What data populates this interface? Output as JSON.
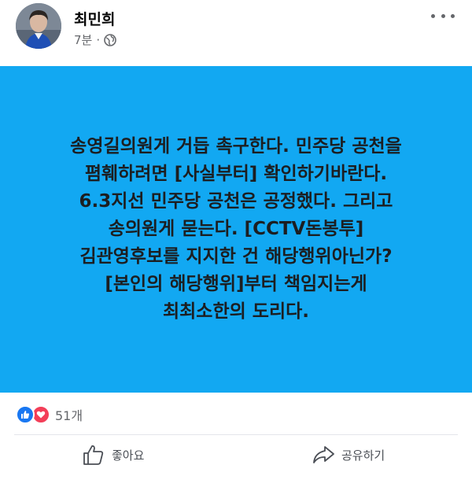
{
  "post": {
    "author_name": "최민희",
    "time_ago": "7분",
    "separator": "·",
    "visibility_icon": "globe-icon",
    "menu_icon": "more-horizontal-icon",
    "body": "송영길의원게 거듭 촉구한다. 민주당 공천을 폄훼하려면 [사실부터] 확인하기바란다. 6.3지선 민주당 공천은 공정했다. 그리고 송의원게 묻는다. [CCTV돈봉투] 김관영후보를 지지한 건 해당행위아닌가? [본인의 해당행위]부터 책임지는게 최최소한의 도리다.",
    "background_color": "#12a8f2"
  },
  "reactions": {
    "icons": [
      "like-reaction-icon",
      "love-reaction-icon"
    ],
    "count_label": "51개"
  },
  "actions": {
    "like_label": "좋아요",
    "share_label": "공유하기"
  }
}
